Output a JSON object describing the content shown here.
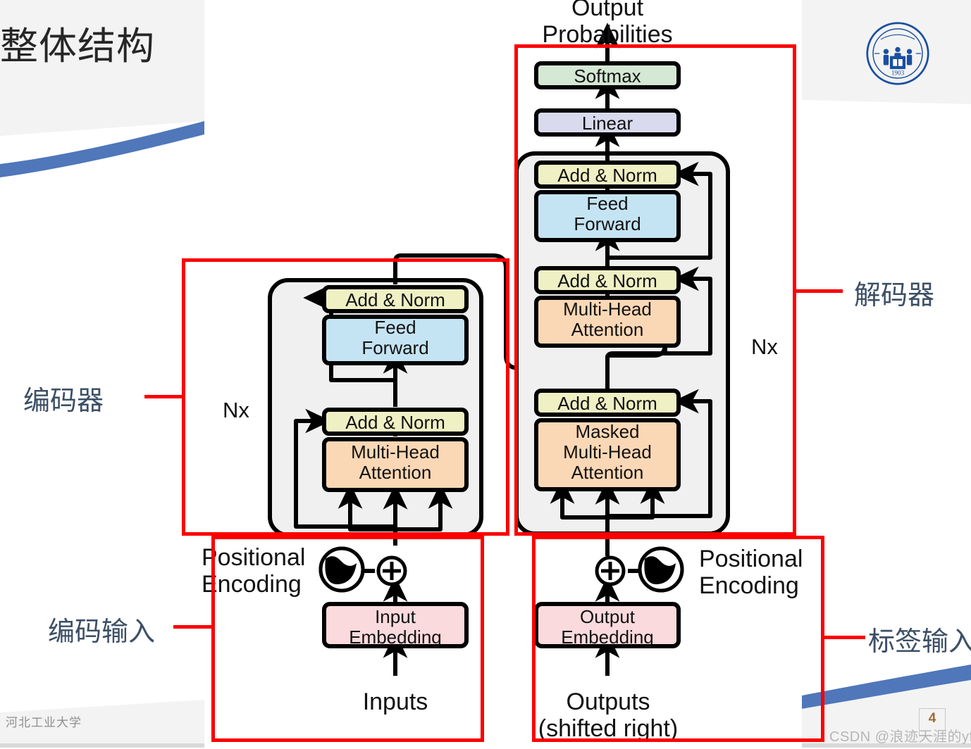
{
  "slide": {
    "title": "整体结构",
    "footer_university": "河北工业大学",
    "page_number": "4",
    "watermark": "CSDN @浪迹天涯的yf",
    "logo_alt": "hebei-university-of-technology-logo",
    "logo_year": "1903",
    "accent_blue": "#4f77ba",
    "panel_gray": "#f3f3f3",
    "annotation_red": "#fb0000",
    "annotation_text_color": "#3c4f66"
  },
  "diagram": {
    "name": "transformer-architecture",
    "top_label": "Output\nProbabilities",
    "encoder": {
      "repeat_label": "Nx",
      "blocks": [
        {
          "id": "enc-add-norm-2",
          "label": "Add & Norm",
          "color": "#eff0c4"
        },
        {
          "id": "enc-feed-forward",
          "label": "Feed\nForward",
          "color": "#c5e4f3"
        },
        {
          "id": "enc-add-norm-1",
          "label": "Add & Norm",
          "color": "#eff0c4"
        },
        {
          "id": "enc-multi-head-attention",
          "label": "Multi-Head\nAttention",
          "color": "#fbd8b5"
        }
      ],
      "input_embedding": {
        "label": "Input\nEmbedding",
        "color": "#fadadd"
      },
      "positional_encoding": "Positional\nEncoding",
      "input_label": "Inputs"
    },
    "decoder": {
      "repeat_label": "Nx",
      "softmax": {
        "label": "Softmax",
        "color": "#d4e8d4"
      },
      "linear": {
        "label": "Linear",
        "color": "#dadaef"
      },
      "blocks": [
        {
          "id": "dec-add-norm-3",
          "label": "Add & Norm",
          "color": "#eff0c4"
        },
        {
          "id": "dec-feed-forward",
          "label": "Feed\nForward",
          "color": "#c5e4f3"
        },
        {
          "id": "dec-add-norm-2",
          "label": "Add & Norm",
          "color": "#eff0c4"
        },
        {
          "id": "dec-cross-attention",
          "label": "Multi-Head\nAttention",
          "color": "#fbd8b5"
        },
        {
          "id": "dec-add-norm-1",
          "label": "Add & Norm",
          "color": "#eff0c4"
        },
        {
          "id": "dec-masked-attention",
          "label": "Masked\nMulti-Head\nAttention",
          "color": "#fbd8b5"
        }
      ],
      "output_embedding": {
        "label": "Output\nEmbedding",
        "color": "#fadadd"
      },
      "positional_encoding": "Positional\nEncoding",
      "output_label": "Outputs\n(shifted right)"
    }
  },
  "annotations": [
    {
      "id": "encoder",
      "label": "编码器"
    },
    {
      "id": "decoder",
      "label": "解码器"
    },
    {
      "id": "encoder-input",
      "label": "编码输入"
    },
    {
      "id": "label-input",
      "label": "标签输入"
    }
  ]
}
